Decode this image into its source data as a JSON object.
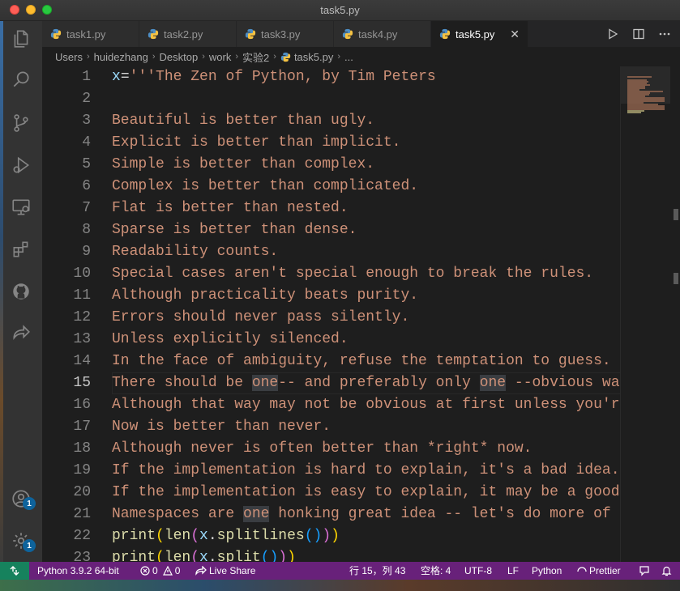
{
  "window": {
    "title": "task5.py"
  },
  "tabs": [
    {
      "label": "task1.py"
    },
    {
      "label": "task2.py"
    },
    {
      "label": "task3.py"
    },
    {
      "label": "task4.py"
    },
    {
      "label": "task5.py",
      "active": true
    }
  ],
  "breadcrumb": {
    "items": [
      "Users",
      "huidezhang",
      "Desktop",
      "work",
      "实验2",
      "task5.py",
      "..."
    ]
  },
  "editor": {
    "current_line": 15,
    "lines": [
      {
        "n": "1",
        "text": "x='''The Zen of Python, by Tim Peters"
      },
      {
        "n": "2",
        "text": ""
      },
      {
        "n": "3",
        "text": "Beautiful is better than ugly."
      },
      {
        "n": "4",
        "text": "Explicit is better than implicit."
      },
      {
        "n": "5",
        "text": "Simple is better than complex."
      },
      {
        "n": "6",
        "text": "Complex is better than complicated."
      },
      {
        "n": "7",
        "text": "Flat is better than nested."
      },
      {
        "n": "8",
        "text": "Sparse is better than dense."
      },
      {
        "n": "9",
        "text": "Readability counts."
      },
      {
        "n": "10",
        "text": "Special cases aren't special enough to break the rules."
      },
      {
        "n": "11",
        "text": "Although practicality beats purity."
      },
      {
        "n": "12",
        "text": "Errors should never pass silently."
      },
      {
        "n": "13",
        "text": "Unless explicitly silenced."
      },
      {
        "n": "14",
        "text": "In the face of ambiguity, refuse the temptation to guess."
      },
      {
        "n": "15",
        "text": "There should be one-- and preferably only one --obvious wa"
      },
      {
        "n": "16",
        "text": "Although that way may not be obvious at first unless you'r"
      },
      {
        "n": "17",
        "text": "Now is better than never."
      },
      {
        "n": "18",
        "text": "Although never is often better than *right* now."
      },
      {
        "n": "19",
        "text": "If the implementation is hard to explain, it's a bad idea."
      },
      {
        "n": "20",
        "text": "If the implementation is easy to explain, it may be a good"
      },
      {
        "n": "21",
        "text": "Namespaces are one honking great idea -- let's do more of"
      },
      {
        "n": "22",
        "text": "print(len(x.splitlines()))"
      },
      {
        "n": "23",
        "text": "print(len(x.split()))"
      }
    ]
  },
  "statusbar": {
    "interpreter": "Python 3.9.2 64-bit",
    "errors": "0",
    "warnings": "0",
    "live_share": "Live Share",
    "position": "行 15，列 43",
    "indent": "空格: 4",
    "encoding": "UTF-8",
    "eol": "LF",
    "language": "Python",
    "formatter": "Prettier"
  },
  "activity_badges": {
    "accounts": "1",
    "settings": "1"
  },
  "colors": {
    "string": "#ce9178",
    "statusbar_bg": "#68217a",
    "remote_bg": "#16825d",
    "editor_bg": "#1e1e1e",
    "badge": "#0e639c"
  }
}
